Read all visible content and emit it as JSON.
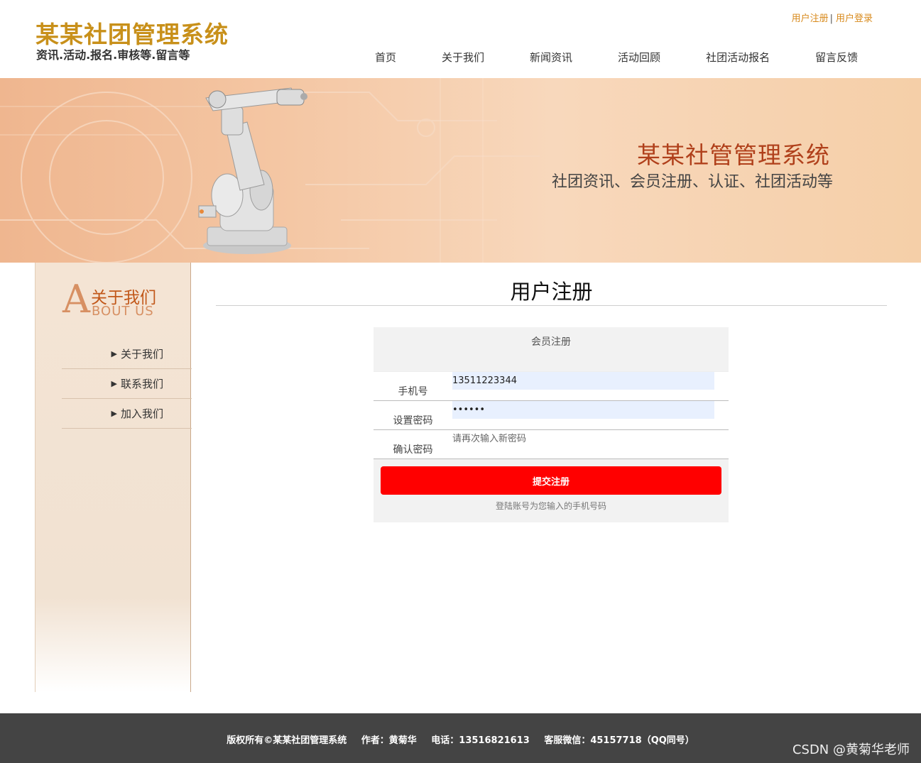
{
  "header": {
    "logo_title": "某某社团管理系统",
    "logo_sub": "资讯.活动.报名.审核等.留言等",
    "register_link": "用户注册",
    "login_link": "用户登录",
    "separator": "|",
    "nav": [
      "首页",
      "关于我们",
      "新闻资讯",
      "活动回顾",
      "社团活动报名",
      "留言反馈"
    ]
  },
  "banner": {
    "title": "某某社管管理系统",
    "subtitle": "社团资讯、会员注册、认证、社团活动等"
  },
  "sidebar": {
    "big_letter": "A",
    "heading_cn": "关于我们",
    "heading_en": "BOUT US",
    "items": [
      "关于我们",
      "联系我们",
      "加入我们"
    ]
  },
  "main": {
    "page_title": "用户注册",
    "form": {
      "header": "会员注册",
      "phone_label": "手机号",
      "phone_value": "13511223344",
      "password_label": "设置密码",
      "password_value": "••••••",
      "confirm_label": "确认密码",
      "confirm_placeholder": "请再次输入新密码",
      "submit_label": "提交注册",
      "hint": "登陆账号为您输入的手机号码"
    }
  },
  "footer": {
    "copyright": "版权所有©某某社团管理系统",
    "author": "作者：黄菊华",
    "phone": "电话：13516821613",
    "wechat": "客服微信：45157718（QQ同号）",
    "watermark": "CSDN @黄菊华老师"
  },
  "colors": {
    "logo": "#c8901a",
    "accent_link": "#d88a1c",
    "banner_title": "#b0401b",
    "submit": "#ff0000",
    "footer_bg": "#444444"
  }
}
